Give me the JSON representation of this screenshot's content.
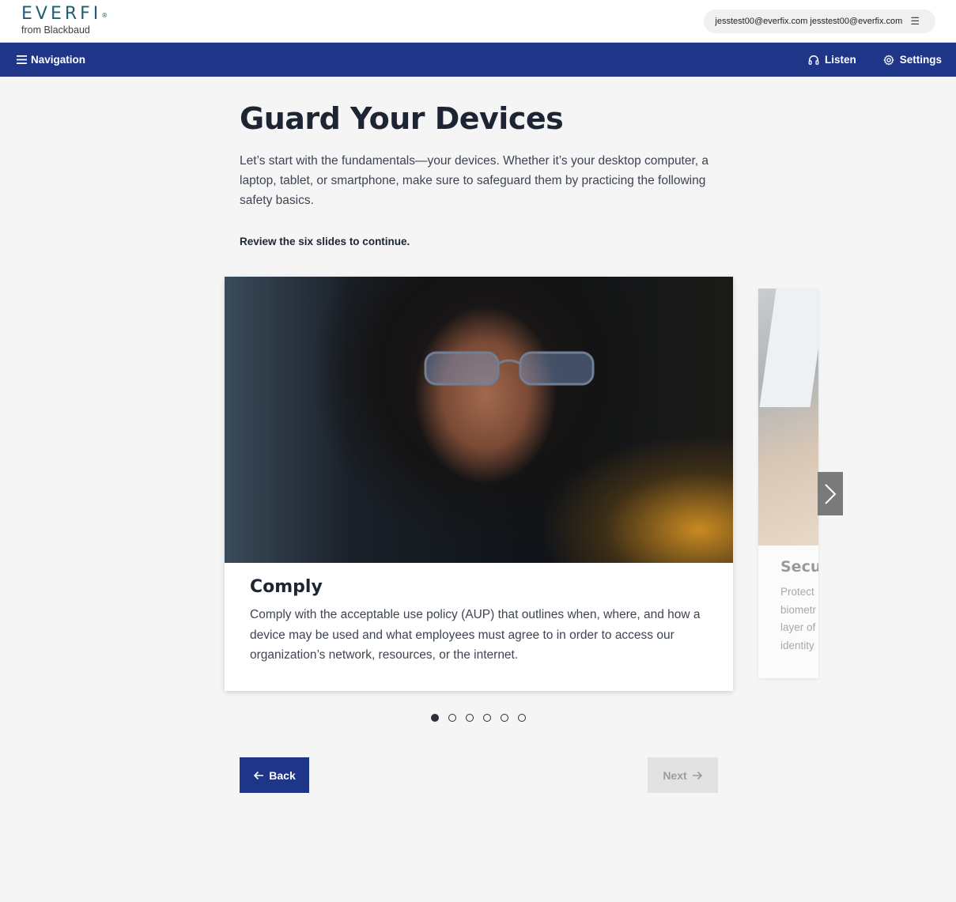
{
  "header": {
    "logo_text": "EVERFI",
    "logo_mark": "®",
    "logo_sub": "from Blackbaud",
    "user_email": "jesstest00@everfix.com jesstest00@everfix.com",
    "menu_icon": "menu-icon"
  },
  "navbar": {
    "navigation_label": "Navigation",
    "listen_label": "Listen",
    "settings_label": "Settings"
  },
  "page": {
    "title": "Guard Your Devices",
    "intro": "Let’s start with the fundamentals—your devices. Whether it’s your desktop computer, a laptop, tablet, or smartphone, make sure to safeguard them by practicing the following safety basics.",
    "instruction": "Review the six slides to continue."
  },
  "carousel": {
    "slide_count": 6,
    "active_index": 0,
    "current_slide": {
      "title": "Comply",
      "text": "Comply with the acceptable use policy (AUP) that outlines when, where, and how a device may be used and what employees must agree to in order to access our organization’s network, resources, or the internet."
    },
    "peek_slide": {
      "title": "Secu",
      "lines": [
        "Protect",
        "biometr",
        "layer of",
        "identity"
      ]
    }
  },
  "buttons": {
    "back_label": "Back",
    "next_label": "Next"
  },
  "colors": {
    "brand_blue": "#1f3587",
    "logo_teal": "#1e5f74",
    "background": "#f5f5f5",
    "disabled": "#e2e2e2"
  }
}
